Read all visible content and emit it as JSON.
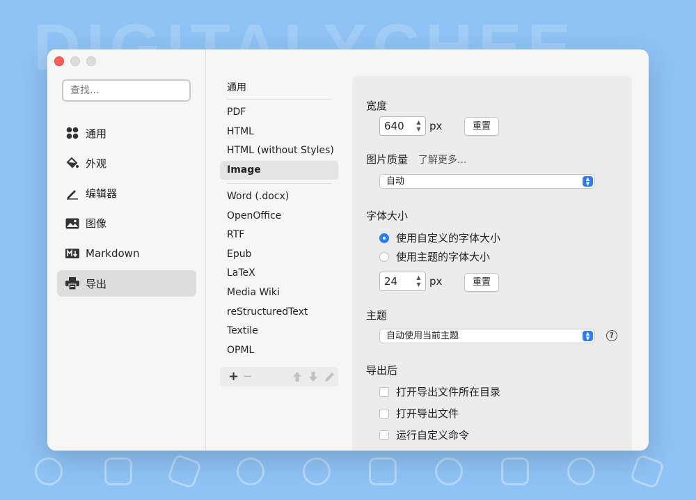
{
  "background": {
    "watermark": "DIGITALYCHEE",
    "color": "#8fc3f5"
  },
  "window": {
    "traffic_lights": [
      "close",
      "minimize",
      "maximize"
    ],
    "accent": "#2b7cf6"
  },
  "sidebar": {
    "search_placeholder": "查找...",
    "items": [
      {
        "label": "通用",
        "icon": "grid-icon",
        "active": false
      },
      {
        "label": "外观",
        "icon": "paint-bucket-icon",
        "active": false
      },
      {
        "label": "编辑器",
        "icon": "pencil-icon",
        "active": false
      },
      {
        "label": "图像",
        "icon": "image-icon",
        "active": false
      },
      {
        "label": "Markdown",
        "icon": "markdown-icon",
        "active": false
      },
      {
        "label": "导出",
        "icon": "printer-icon",
        "active": true
      }
    ]
  },
  "formats": {
    "header": "通用",
    "group1": [
      "PDF",
      "HTML",
      "HTML (without Styles)",
      "Image"
    ],
    "group2": [
      "Word (.docx)",
      "OpenOffice",
      "RTF",
      "Epub",
      "LaTeX",
      "Media Wiki",
      "reStructuredText",
      "Textile",
      "OPML"
    ],
    "selected": "Image",
    "toolbar": {
      "add": "+",
      "remove": "−",
      "up": "up-arrow-icon",
      "down": "down-arrow-icon",
      "edit": "pencil-icon"
    }
  },
  "panel": {
    "width": {
      "label": "宽度",
      "value": "640",
      "unit": "px",
      "reset": "重置"
    },
    "quality": {
      "label": "图片质量",
      "learn_more": "了解更多...",
      "value": "自动"
    },
    "font_size": {
      "label": "字体大小",
      "option_custom": "使用自定义的字体大小",
      "option_theme": "使用主题的字体大小",
      "selected": "custom",
      "value": "24",
      "unit": "px",
      "reset": "重置"
    },
    "theme": {
      "label": "主题",
      "value": "自动使用当前主题",
      "help": "?"
    },
    "after_export": {
      "label": "导出后",
      "options": [
        "打开导出文件所在目录",
        "打开导出文件",
        "运行自定义命令"
      ]
    }
  }
}
